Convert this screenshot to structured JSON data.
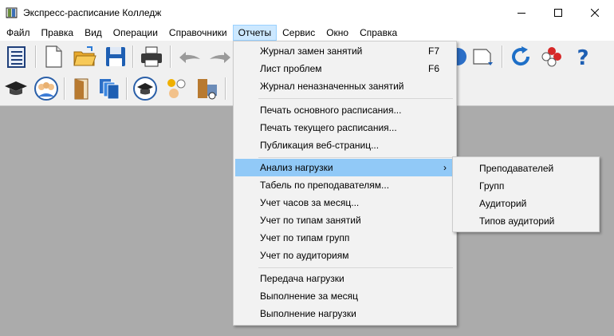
{
  "window": {
    "title": "Экспресс-расписание Колледж",
    "icon": "book-icon"
  },
  "menubar": {
    "items": [
      "Файл",
      "Правка",
      "Вид",
      "Операции",
      "Справочники",
      "Отчеты",
      "Сервис",
      "Окно",
      "Справка"
    ],
    "active": "Отчеты"
  },
  "reports_menu": {
    "items": [
      {
        "label": "Журнал замен занятий",
        "shortcut": "F7"
      },
      {
        "label": "Лист проблем",
        "shortcut": "F6"
      },
      {
        "label": "Журнал неназначенных занятий",
        "shortcut": ""
      },
      {
        "label": "Печать основного расписания...",
        "shortcut": ""
      },
      {
        "label": "Печать текущего расписания...",
        "shortcut": ""
      },
      {
        "label": "Публикация веб-страниц...",
        "shortcut": ""
      },
      {
        "label": "Анализ нагрузки",
        "shortcut": "",
        "submenu": true,
        "highlighted": true
      },
      {
        "label": "Табель по преподавателям...",
        "shortcut": ""
      },
      {
        "label": "Учет часов за месяц...",
        "shortcut": ""
      },
      {
        "label": "Учет по типам занятий",
        "shortcut": ""
      },
      {
        "label": "Учет по типам групп",
        "shortcut": ""
      },
      {
        "label": "Учет по аудиториям",
        "shortcut": ""
      },
      {
        "label": "Передача нагрузки",
        "shortcut": ""
      },
      {
        "label": "Выполнение за месяц",
        "shortcut": ""
      },
      {
        "label": "Выполнение нагрузки",
        "shortcut": ""
      }
    ],
    "submenu_arrow": "›"
  },
  "load_analysis_submenu": {
    "items": [
      "Преподавателей",
      "Групп",
      "Аудиторий",
      "Типов аудиторий"
    ]
  },
  "colors": {
    "menu_highlight": "#91c9f7",
    "menubar_active": "#cce8ff",
    "workspace": "#ababab"
  }
}
